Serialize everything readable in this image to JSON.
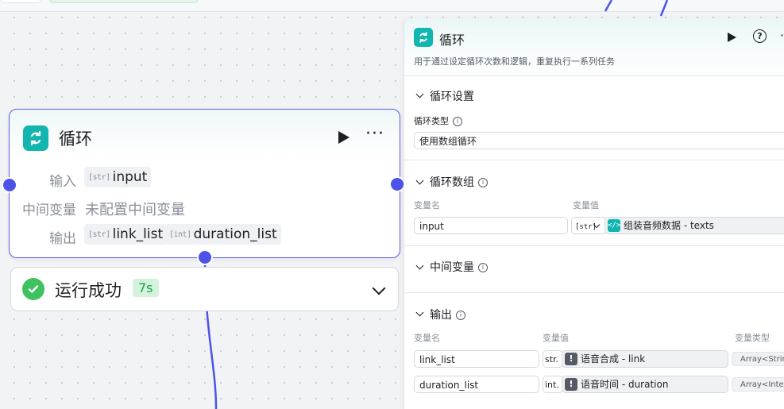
{
  "node": {
    "title": "循环",
    "input_label": "输入",
    "input_type": "[str]",
    "input_value": "input",
    "mid_label": "中间变量",
    "mid_value": "未配置中间变量",
    "output_label": "输出",
    "outputs": [
      {
        "type": "[str]",
        "name": "link_list"
      },
      {
        "type": "[int]",
        "name": "duration_list"
      }
    ]
  },
  "status": {
    "text": "运行成功",
    "time": "7s"
  },
  "panel": {
    "title": "循环",
    "description": "用于通过设定循环次数和逻辑，重复执行一系列任务",
    "loop_settings": {
      "title": "循环设置",
      "type_label": "循环类型",
      "type_value": "使用数组循环"
    },
    "loop_array": {
      "title": "循环数组",
      "col_name": "变量名",
      "col_value": "变量值",
      "row": {
        "name": "input",
        "type": "[str]",
        "ref": "组装音频数据 - texts"
      }
    },
    "mid_vars": {
      "title": "中间变量"
    },
    "output": {
      "title": "输出",
      "col_name": "变量名",
      "col_value": "变量值",
      "col_type": "变量类型",
      "rows": [
        {
          "name": "link_list",
          "type": "str.",
          "ref": "语音合成 - link",
          "vartype": "Array<String>"
        },
        {
          "name": "duration_list",
          "type": "int.",
          "ref": "语音时间 - duration",
          "vartype": "Array<Integer>"
        }
      ]
    }
  },
  "colors": {
    "accent": "#4d53e8",
    "teal": "#12b5b0",
    "success": "#3ec25f"
  }
}
